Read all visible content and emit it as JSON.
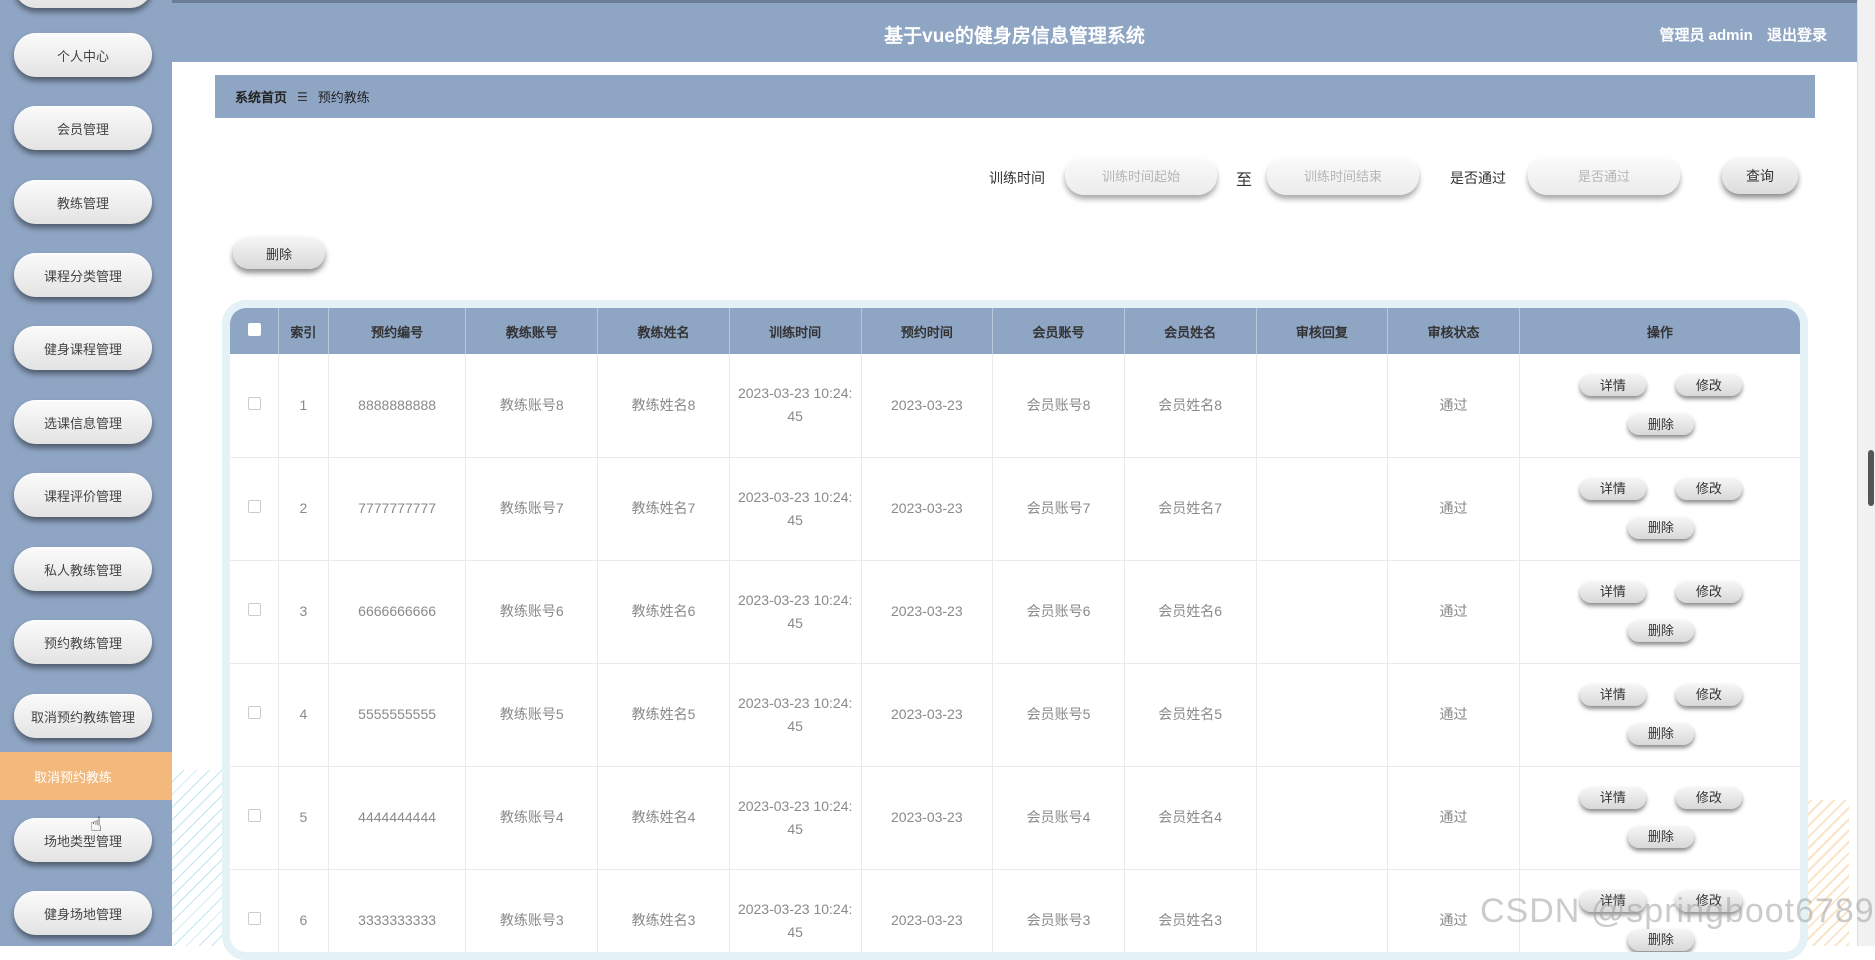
{
  "header": {
    "title": "基于vue的健身房信息管理系统",
    "user": "管理员 admin",
    "logout": "退出登录"
  },
  "sidebar": {
    "items": [
      {
        "label": "个人中心"
      },
      {
        "label": "会员管理"
      },
      {
        "label": "教练管理"
      },
      {
        "label": "课程分类管理"
      },
      {
        "label": "健身课程管理"
      },
      {
        "label": "选课信息管理"
      },
      {
        "label": "课程评价管理"
      },
      {
        "label": "私人教练管理"
      },
      {
        "label": "预约教练管理"
      },
      {
        "label": "取消预约教练管理"
      },
      {
        "label": "场地类型管理"
      },
      {
        "label": "健身场地管理"
      }
    ],
    "active_sub": "取消预约教练"
  },
  "breadcrumb": {
    "home": "系统首页",
    "sep": "☰",
    "current": "预约教练"
  },
  "search": {
    "time_label": "训练时间",
    "start_placeholder": "训练时间起始",
    "to_label": "至",
    "end_placeholder": "训练时间结束",
    "pass_label": "是否通过",
    "pass_placeholder": "是否通过",
    "query_button": "查询"
  },
  "toolbar": {
    "delete_label": "删除"
  },
  "table": {
    "columns": [
      "索引",
      "预约编号",
      "教练账号",
      "教练姓名",
      "训练时间",
      "预约时间",
      "会员账号",
      "会员姓名",
      "审核回复",
      "审核状态",
      "操作"
    ],
    "rows": [
      {
        "index": "1",
        "code": "8888888888",
        "coach_account": "教练账号8",
        "coach_name": "教练姓名8",
        "train_time": "2023-03-23 10:24:45",
        "book_time": "2023-03-23",
        "member_account": "会员账号8",
        "member_name": "会员姓名8",
        "reply": "",
        "status": "通过"
      },
      {
        "index": "2",
        "code": "7777777777",
        "coach_account": "教练账号7",
        "coach_name": "教练姓名7",
        "train_time": "2023-03-23 10:24:45",
        "book_time": "2023-03-23",
        "member_account": "会员账号7",
        "member_name": "会员姓名7",
        "reply": "",
        "status": "通过"
      },
      {
        "index": "3",
        "code": "6666666666",
        "coach_account": "教练账号6",
        "coach_name": "教练姓名6",
        "train_time": "2023-03-23 10:24:45",
        "book_time": "2023-03-23",
        "member_account": "会员账号6",
        "member_name": "会员姓名6",
        "reply": "",
        "status": "通过"
      },
      {
        "index": "4",
        "code": "5555555555",
        "coach_account": "教练账号5",
        "coach_name": "教练姓名5",
        "train_time": "2023-03-23 10:24:45",
        "book_time": "2023-03-23",
        "member_account": "会员账号5",
        "member_name": "会员姓名5",
        "reply": "",
        "status": "通过"
      },
      {
        "index": "5",
        "code": "4444444444",
        "coach_account": "教练账号4",
        "coach_name": "教练姓名4",
        "train_time": "2023-03-23 10:24:45",
        "book_time": "2023-03-23",
        "member_account": "会员账号4",
        "member_name": "会员姓名4",
        "reply": "",
        "status": "通过"
      },
      {
        "index": "6",
        "code": "3333333333",
        "coach_account": "教练账号3",
        "coach_name": "教练姓名3",
        "train_time": "2023-03-23 10:24:45",
        "book_time": "2023-03-23",
        "member_account": "会员账号3",
        "member_name": "会员姓名3",
        "reply": "",
        "status": "通过"
      }
    ],
    "actions": {
      "detail": "详情",
      "edit": "修改",
      "delete": "删除"
    }
  },
  "watermark": "CSDN @springboot6789",
  "colors": {
    "primary": "#8fa5c4",
    "active_sub": "#f3b97c"
  },
  "icons": {
    "cursor": "pointer-hand-icon"
  }
}
